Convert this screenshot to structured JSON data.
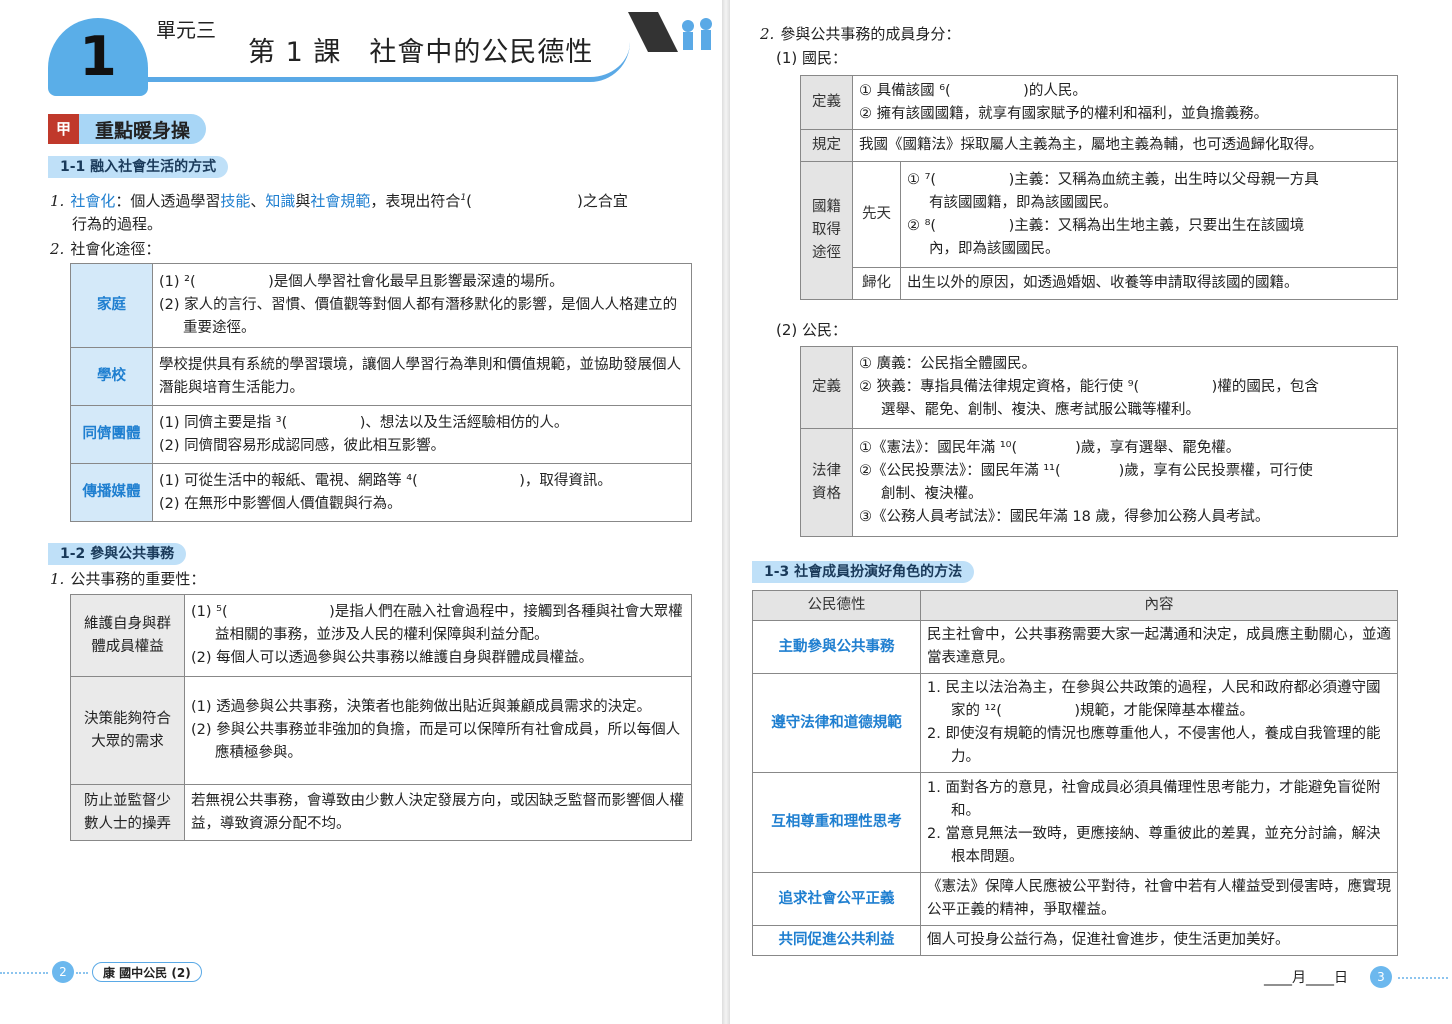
{
  "header": {
    "unit_number": "1",
    "unit_label": "單元三",
    "lesson_title": "第 1 課　社會中的公民德性"
  },
  "section_main": {
    "mark": "甲",
    "title": "重點暖身操"
  },
  "s11": {
    "tag": "1-1 融入社會生活的方式",
    "l1_num": "1.",
    "l1_term": "社會化",
    "l1_a": "：個人透過學習",
    "l1_b": "技能",
    "l1_c": "、",
    "l1_d": "知識",
    "l1_e": "與",
    "l1_f": "社會規範",
    "l1_g": "，表現出符合",
    "l1_sup": "1",
    "l1_h": "(　　　　　　　)之合宜",
    "l1_i": "行為的過程。",
    "l2_num": "2.",
    "l2": "社會化途徑：",
    "rows": [
      {
        "head": "家庭",
        "lines": [
          "(1) ²(　　　　　)是個人學習社會化最早且影響最深遠的場所。",
          "(2) 家人的言行、習慣、價值觀等對個人都有潛移默化的影響，是個人人格建立的重要途徑。"
        ]
      },
      {
        "head": "學校",
        "lines": [
          "學校提供具有系統的學習環境，讓個人學習行為準則和價值規範，並協助發展個人潛能與培育生活能力。"
        ]
      },
      {
        "head": "同儕團體",
        "lines": [
          "(1) 同儕主要是指 ³(　　　　　)、想法以及生活經驗相仿的人。",
          "(2) 同儕間容易形成認同感，彼此相互影響。"
        ]
      },
      {
        "head": "傳播媒體",
        "lines": [
          "(1) 可從生活中的報紙、電視、網路等 ⁴(　　　　　　　)，取得資訊。",
          "(2) 在無形中影響個人價值觀與行為。"
        ]
      }
    ]
  },
  "s12": {
    "tag": "1-2 參與公共事務",
    "l1_num": "1.",
    "l1": "公共事務的重要性：",
    "rows": [
      {
        "head": "維護自身與群體成員權益",
        "lines": [
          "(1) ⁵(　　　　　　　)是指人們在融入社會過程中，接觸到各種與社會大眾權益相關的事務，並涉及人民的權利保障與利益分配。",
          "(2) 每個人可以透過參與公共事務以維護自身與群體成員權益。"
        ]
      },
      {
        "head": "決策能夠符合大眾的需求",
        "lines": [
          "(1) 透過參與公共事務，決策者也能夠做出貼近與兼顧成員需求的決定。",
          "(2) 參與公共事務並非強加的負擔，而是可以保障所有社會成員，所以每個人應積極參與。"
        ]
      },
      {
        "head": "防止並監督少數人士的操弄",
        "lines": [
          "若無視公共事務，會導致由少數人決定發展方向，或因缺乏監督而影響個人權益，導致資源分配不均。"
        ]
      }
    ]
  },
  "footer_left": {
    "page": "2",
    "book": "康 國中公民 (2)"
  },
  "right": {
    "l2_num": "2.",
    "l2": "參與公共事務的成員身分：",
    "p1": "(1) 國民：",
    "citizen_nat": {
      "def_head": "定義",
      "def1": "① 具備該國 ⁶(　　　　　)的人民。",
      "def2": "② 擁有該國國籍，就享有國家賦予的權利和福利，並負擔義務。",
      "law_head": "規定",
      "law": "我國《國籍法》採取屬人主義為主，屬地主義為輔，也可透過歸化取得。",
      "acq_head": "國籍取得途徑",
      "innate_head": "先天",
      "innate1a": "① ⁷(　　　　　)主義：又稱為血統主義，出生時以父母親一方具",
      "innate1b": "有該國國籍，即為該國國民。",
      "innate2a": "② ⁸(　　　　　)主義：又稱為出生地主義，只要出生在該國境",
      "innate2b": "內，即為該國國民。",
      "natur_head": "歸化",
      "natur": "出生以外的原因，如透過婚姻、收養等申請取得該國的國籍。"
    },
    "p2": "(2) 公民：",
    "citizen": {
      "def_head": "定義",
      "def1": "① 廣義：公民指全體國民。",
      "def2a": "② 狹義：專指具備法律規定資格，能行使 ⁹(　　　　　)權的國民，包含",
      "def2b": "選舉、罷免、創制、複決、應考試服公職等權利。",
      "law_head": "法律資格",
      "law1": "①《憲法》：國民年滿 ¹⁰(　　　　)歲，享有選舉、罷免權。",
      "law2a": "②《公民投票法》：國民年滿 ¹¹(　　　　)歲，享有公民投票權，可行使",
      "law2b": "創制、複決權。",
      "law3": "③《公務人員考試法》：國民年滿 18 歲，得參加公務人員考試。"
    },
    "s13_tag": "1-3 社會成員扮演好角色的方法",
    "virtue_table": {
      "col1": "公民德性",
      "col2": "內容",
      "rows": [
        {
          "head": "主動參與公共事務",
          "lines": [
            "民主社會中，公共事務需要大家一起溝通和決定，成員應主動關心，並適當表達意見。"
          ]
        },
        {
          "head": "遵守法律和道德規範",
          "lines": [
            "1. 民主以法治為主，在參與公共政策的過程，人民和政府都必須遵守國家的 ¹²(　　　　　)規範，才能保障基本權益。",
            "2. 即使沒有規範的情況也應尊重他人，不侵害他人，養成自我管理的能力。"
          ]
        },
        {
          "head": "互相尊重和理性思考",
          "lines": [
            "1. 面對各方的意見，社會成員必須具備理性思考能力，才能避免盲從附和。",
            "2. 當意見無法一致時，更應接納、尊重彼此的差異，並充分討論，解決根本問題。"
          ]
        },
        {
          "head": "追求社會公平正義",
          "lines": [
            "《憲法》保障人民應被公平對待，社會中若有人權益受到侵害時，應實現公平正義的精神，爭取權益。"
          ]
        },
        {
          "head": "共同促進公共利益",
          "lines": [
            "個人可投身公益行為，促進社會進步，使生活更加美好。"
          ]
        }
      ]
    }
  },
  "footer_right": {
    "page": "3",
    "date": "____月____日"
  },
  "colors": {
    "accent": "#1f7fd0",
    "tag_bg": "#bfe0f8",
    "head_bg": "#d4e9f9",
    "mark": "#c0392b"
  }
}
